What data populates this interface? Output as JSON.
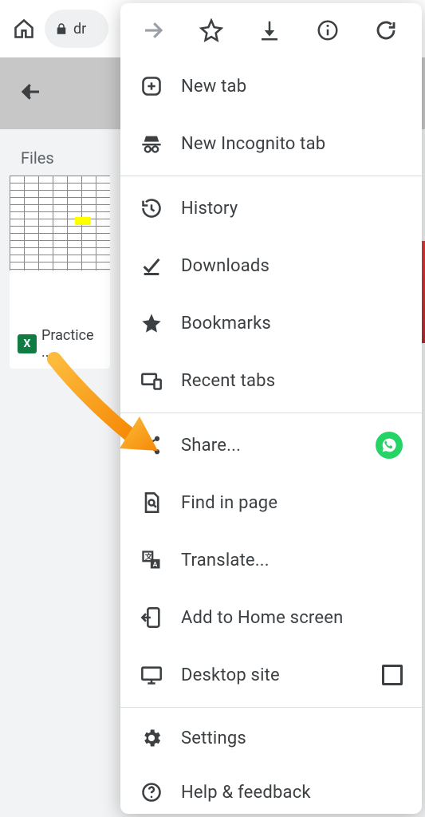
{
  "browser": {
    "url_fragment": "dr",
    "icons": {
      "home": "home-icon",
      "lock": "lock-icon",
      "forward": "forward-icon",
      "star": "star-icon",
      "download": "download-icon",
      "info": "info-icon",
      "reload": "reload-icon"
    }
  },
  "page": {
    "back_icon": "back-icon",
    "section_label": "Files",
    "files": [
      {
        "name": "Practice ...",
        "type_badge": "X"
      }
    ]
  },
  "menu": {
    "items": [
      {
        "icon": "plus-square-icon",
        "label": "New tab"
      },
      {
        "icon": "incognito-icon",
        "label": "New Incognito tab"
      },
      {
        "divider": true
      },
      {
        "icon": "history-icon",
        "label": "History"
      },
      {
        "icon": "check-underline-icon",
        "label": "Downloads"
      },
      {
        "icon": "star-filled-icon",
        "label": "Bookmarks"
      },
      {
        "icon": "recent-tabs-icon",
        "label": "Recent tabs"
      },
      {
        "divider": true
      },
      {
        "icon": "share-icon",
        "label": "Share...",
        "right": "whatsapp"
      },
      {
        "icon": "find-in-page-icon",
        "label": "Find in page"
      },
      {
        "icon": "translate-icon",
        "label": "Translate..."
      },
      {
        "icon": "add-home-icon",
        "label": "Add to Home screen"
      },
      {
        "icon": "desktop-icon",
        "label": "Desktop site",
        "right": "checkbox"
      },
      {
        "divider": true
      },
      {
        "icon": "gear-icon",
        "label": "Settings"
      },
      {
        "icon": "help-icon",
        "label": "Help & feedback"
      }
    ]
  },
  "annotation": {
    "type": "arrow",
    "color": "#f7a11b",
    "target": "share-menu-item"
  }
}
